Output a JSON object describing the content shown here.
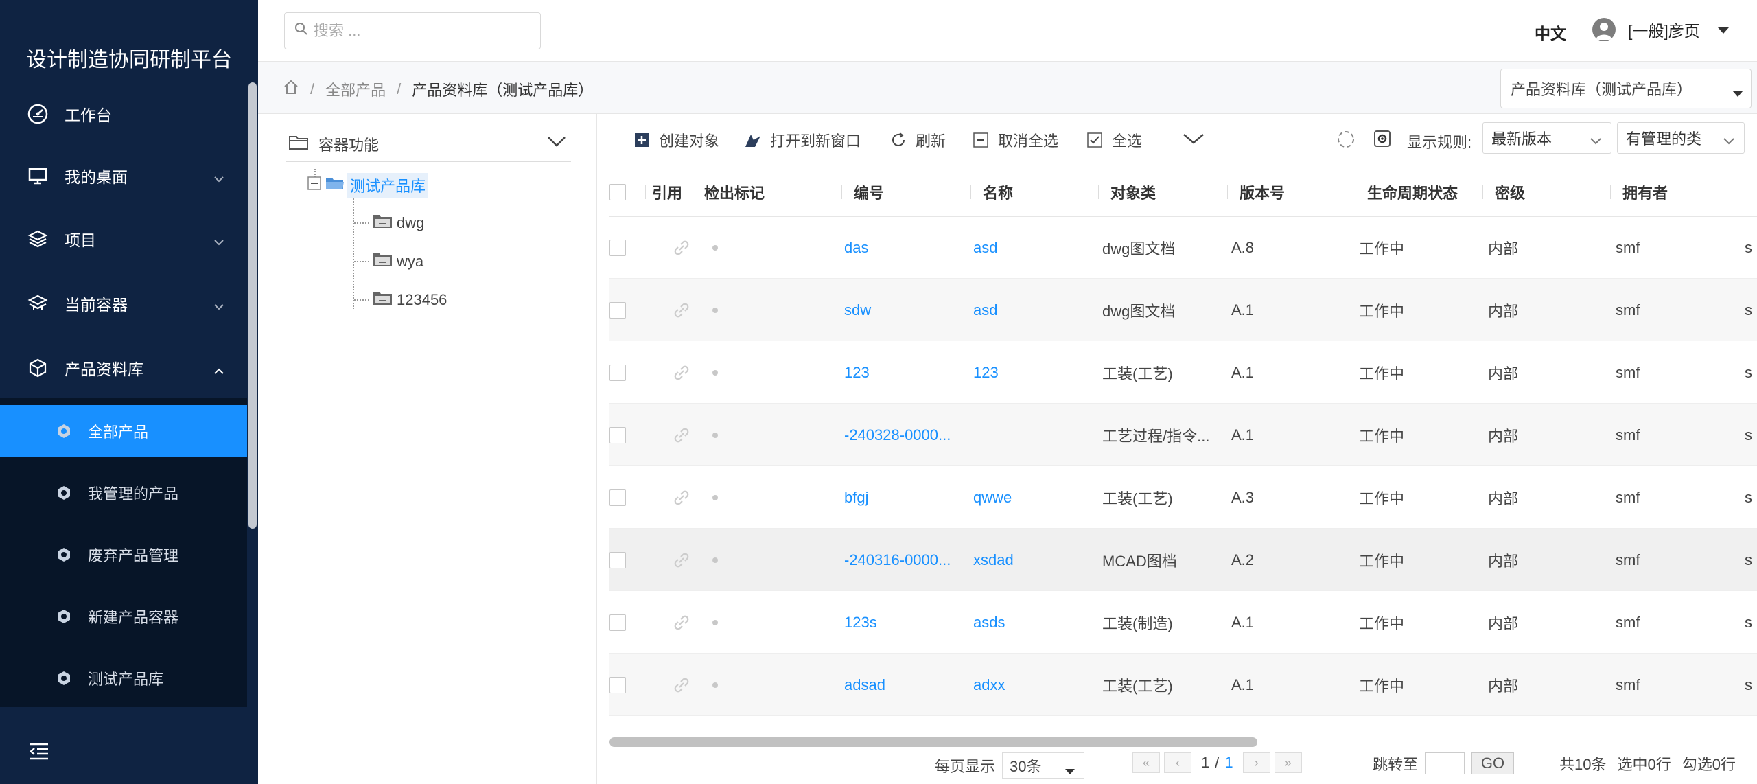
{
  "app": {
    "title": "设计制造协同研制平台"
  },
  "sidebar": {
    "items": [
      {
        "label": "工作台",
        "icon": "dashboard-icon"
      },
      {
        "label": "我的桌面",
        "icon": "monitor-icon"
      },
      {
        "label": "项目",
        "icon": "layers-icon"
      },
      {
        "label": "当前容器",
        "icon": "stack-icon"
      },
      {
        "label": "产品资料库",
        "icon": "cube-icon"
      }
    ],
    "subitems": [
      {
        "label": "全部产品",
        "active": true
      },
      {
        "label": "我管理的产品"
      },
      {
        "label": "废弃产品管理"
      },
      {
        "label": "新建产品容器"
      },
      {
        "label": "测试产品库"
      }
    ]
  },
  "header": {
    "search_placeholder": "搜索 ...",
    "lang": "中文",
    "user": "[一般]彦页"
  },
  "breadcrumb": {
    "items": [
      "全部产品",
      "产品资料库（测试产品库）"
    ],
    "sep": "/",
    "library_select": "产品资料库（测试产品库）"
  },
  "tree": {
    "header": "容器功能",
    "root": "测试产品库",
    "children": [
      "dwg",
      "wya",
      "123456"
    ]
  },
  "toolbar": {
    "create": "创建对象",
    "open_new": "打开到新窗口",
    "refresh": "刷新",
    "deselect": "取消全选",
    "select_all": "全选",
    "rule_label": "显示规则:",
    "version_select": "最新版本",
    "class_select": "有管理的类"
  },
  "table": {
    "columns": [
      "引用",
      "检出标记",
      "编号",
      "名称",
      "对象类",
      "版本号",
      "生命周期状态",
      "密级",
      "拥有者"
    ],
    "rows": [
      {
        "number": "das",
        "name": "asd",
        "type": "dwg图文档",
        "version": "A.8",
        "state": "工作中",
        "secret": "内部",
        "owner": "smf",
        "extra": "s"
      },
      {
        "number": "sdw",
        "name": "asd",
        "type": "dwg图文档",
        "version": "A.1",
        "state": "工作中",
        "secret": "内部",
        "owner": "smf",
        "extra": "s"
      },
      {
        "number": "123",
        "name": "123",
        "type": "工装(工艺)",
        "version": "A.1",
        "state": "工作中",
        "secret": "内部",
        "owner": "smf",
        "extra": "s"
      },
      {
        "number": "-240328-0000...",
        "name": "",
        "type": "工艺过程/指令...",
        "version": "A.1",
        "state": "工作中",
        "secret": "内部",
        "owner": "smf",
        "extra": "s"
      },
      {
        "number": "bfgj",
        "name": "qwwe",
        "type": "工装(工艺)",
        "version": "A.3",
        "state": "工作中",
        "secret": "内部",
        "owner": "smf",
        "extra": "s"
      },
      {
        "number": "-240316-0000...",
        "name": "xsdad",
        "type": "MCAD图档",
        "version": "A.2",
        "state": "工作中",
        "secret": "内部",
        "owner": "smf",
        "extra": "s"
      },
      {
        "number": "123s",
        "name": "asds",
        "type": "工装(制造)",
        "version": "A.1",
        "state": "工作中",
        "secret": "内部",
        "owner": "smf",
        "extra": "s"
      },
      {
        "number": "adsad",
        "name": "adxx",
        "type": "工装(工艺)",
        "version": "A.1",
        "state": "工作中",
        "secret": "内部",
        "owner": "smf",
        "extra": "s"
      }
    ]
  },
  "pagination": {
    "per_page_label": "每页显示",
    "per_page_value": "30条",
    "current": "1",
    "slash": "/",
    "total_pages": "1",
    "jump_label": "跳转至",
    "go": "GO",
    "total": "共10条",
    "selected": "选中0行",
    "checked": "勾选0行"
  },
  "colors": {
    "sidebar_bg": "#0f2342",
    "accent": "#1890ff",
    "link": "#1890ff"
  }
}
